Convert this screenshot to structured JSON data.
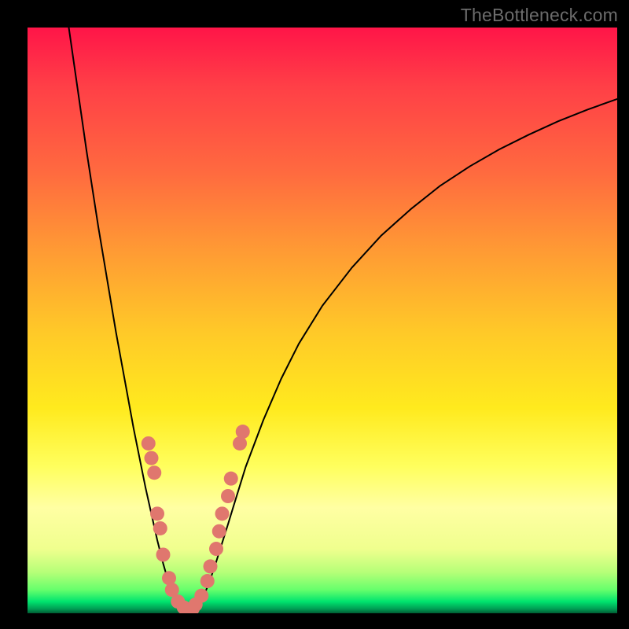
{
  "watermark": "TheBottleneck.com",
  "chart_data": {
    "type": "line",
    "title": "",
    "xlabel": "",
    "ylabel": "",
    "xlim": [
      0,
      100
    ],
    "ylim": [
      0,
      100
    ],
    "curve": {
      "name": "bottleneck-curve",
      "color": "#000000",
      "points": [
        {
          "x": 7.0,
          "y": 100.0
        },
        {
          "x": 8.0,
          "y": 93.0
        },
        {
          "x": 9.0,
          "y": 86.0
        },
        {
          "x": 10.0,
          "y": 79.0
        },
        {
          "x": 11.0,
          "y": 72.5
        },
        {
          "x": 12.0,
          "y": 66.0
        },
        {
          "x": 13.0,
          "y": 60.0
        },
        {
          "x": 14.0,
          "y": 54.0
        },
        {
          "x": 15.0,
          "y": 48.0
        },
        {
          "x": 16.0,
          "y": 42.5
        },
        {
          "x": 17.0,
          "y": 37.0
        },
        {
          "x": 18.0,
          "y": 31.5
        },
        {
          "x": 19.0,
          "y": 26.5
        },
        {
          "x": 20.0,
          "y": 21.5
        },
        {
          "x": 21.0,
          "y": 17.0
        },
        {
          "x": 22.0,
          "y": 12.5
        },
        {
          "x": 23.0,
          "y": 8.5
        },
        {
          "x": 24.0,
          "y": 5.0
        },
        {
          "x": 25.0,
          "y": 2.5
        },
        {
          "x": 26.0,
          "y": 1.0
        },
        {
          "x": 27.0,
          "y": 0.3
        },
        {
          "x": 28.0,
          "y": 0.3
        },
        {
          "x": 29.0,
          "y": 1.3
        },
        {
          "x": 30.0,
          "y": 3.2
        },
        {
          "x": 31.0,
          "y": 5.8
        },
        {
          "x": 32.0,
          "y": 8.8
        },
        {
          "x": 33.0,
          "y": 12.0
        },
        {
          "x": 34.0,
          "y": 15.2
        },
        {
          "x": 35.0,
          "y": 18.5
        },
        {
          "x": 37.0,
          "y": 25.0
        },
        {
          "x": 40.0,
          "y": 33.0
        },
        {
          "x": 43.0,
          "y": 40.0
        },
        {
          "x": 46.0,
          "y": 46.0
        },
        {
          "x": 50.0,
          "y": 52.5
        },
        {
          "x": 55.0,
          "y": 59.0
        },
        {
          "x": 60.0,
          "y": 64.5
        },
        {
          "x": 65.0,
          "y": 69.0
        },
        {
          "x": 70.0,
          "y": 73.0
        },
        {
          "x": 75.0,
          "y": 76.3
        },
        {
          "x": 80.0,
          "y": 79.2
        },
        {
          "x": 85.0,
          "y": 81.7
        },
        {
          "x": 90.0,
          "y": 84.0
        },
        {
          "x": 95.0,
          "y": 86.0
        },
        {
          "x": 100.0,
          "y": 87.8
        }
      ]
    },
    "markers": {
      "name": "sample-points",
      "color": "#E0776E",
      "radius": 1.2,
      "points": [
        {
          "x": 20.5,
          "y": 29.0
        },
        {
          "x": 21.0,
          "y": 26.5
        },
        {
          "x": 21.5,
          "y": 24.0
        },
        {
          "x": 22.0,
          "y": 17.0
        },
        {
          "x": 22.5,
          "y": 14.5
        },
        {
          "x": 23.0,
          "y": 10.0
        },
        {
          "x": 24.0,
          "y": 6.0
        },
        {
          "x": 24.5,
          "y": 4.0
        },
        {
          "x": 25.5,
          "y": 2.0
        },
        {
          "x": 26.5,
          "y": 1.0
        },
        {
          "x": 27.0,
          "y": 0.7
        },
        {
          "x": 27.5,
          "y": 0.6
        },
        {
          "x": 28.0,
          "y": 0.8
        },
        {
          "x": 28.5,
          "y": 1.5
        },
        {
          "x": 29.5,
          "y": 3.0
        },
        {
          "x": 30.5,
          "y": 5.5
        },
        {
          "x": 31.0,
          "y": 8.0
        },
        {
          "x": 32.0,
          "y": 11.0
        },
        {
          "x": 32.5,
          "y": 14.0
        },
        {
          "x": 33.0,
          "y": 17.0
        },
        {
          "x": 34.0,
          "y": 20.0
        },
        {
          "x": 34.5,
          "y": 23.0
        },
        {
          "x": 36.0,
          "y": 29.0
        },
        {
          "x": 36.5,
          "y": 31.0
        }
      ]
    }
  }
}
